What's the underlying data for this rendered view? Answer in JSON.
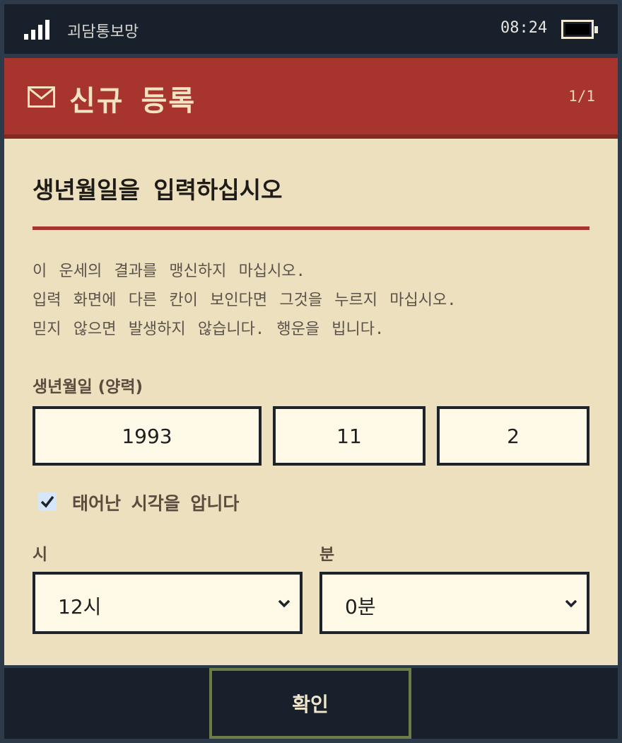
{
  "status_bar": {
    "carrier": "괴담통보망",
    "time": "08:24",
    "signal_icon": "signal-bars-icon",
    "battery_icon": "battery-full-icon"
  },
  "header": {
    "title": "신규 등록",
    "page_indicator": "1/1",
    "icon": "mail-icon"
  },
  "form": {
    "heading": "생년월일을 입력하십시오",
    "notice_lines": [
      "이 운세의 결과를 맹신하지 마십시오.",
      "입력 화면에 다른 칸이 보인다면 그것을 누르지 마십시오.",
      "믿지 않으면 발생하지 않습니다. 행운을 빕니다."
    ],
    "birth_label": "생년월일 (양력)",
    "year": "1993",
    "month": "11",
    "day": "2",
    "know_time_checked": true,
    "know_time_label": "태어난 시각을 압니다",
    "hour_label": "시",
    "minute_label": "분",
    "hour_value": "12시",
    "minute_value": "0분"
  },
  "footer": {
    "confirm_label": "확인"
  },
  "colors": {
    "header_red": "#a8352d",
    "paper": "#ede0bf",
    "dark": "#18202b",
    "button_border": "#6c7d46"
  }
}
